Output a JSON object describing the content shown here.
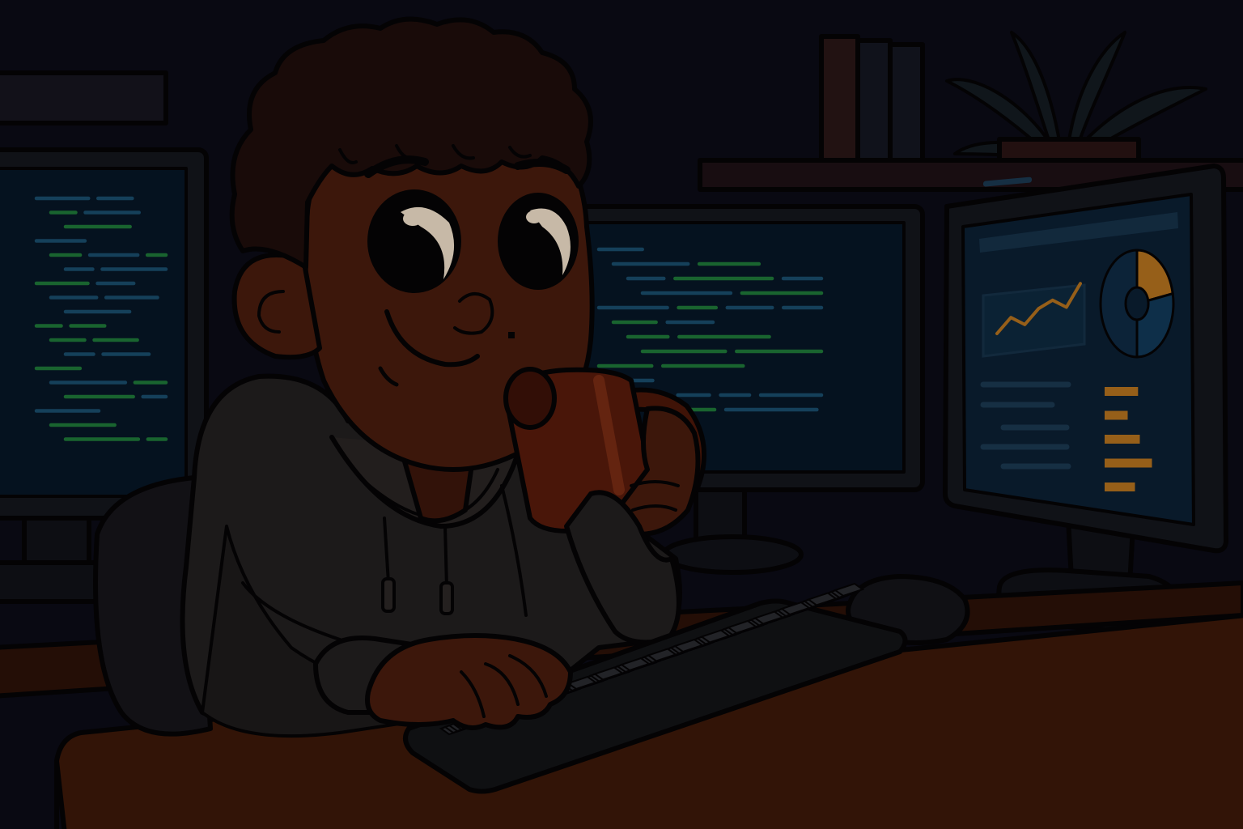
{
  "scene": {
    "background_color": "#0b0a14",
    "wall_color": "#0f0e1c",
    "desk_color": "#3a1608",
    "desk_top_color": "#4a1d0a",
    "skin_color": "#4a1d0e",
    "hoodie_color": "#232020",
    "hair_color": "#1f0e0c",
    "mug_color": "#5a1c0c",
    "keyboard_color": "#131417",
    "screen_color": "#071626",
    "code_green": "#1f7a3a",
    "code_blue": "#1a4f6e",
    "accent_orange": "#b8741f"
  },
  "right_monitor": {
    "line_chart": [
      2,
      4,
      3,
      5,
      6,
      5,
      8
    ],
    "donut_segments": [
      0.22,
      0.28,
      0.5
    ],
    "bar_values": [
      0.55,
      0.38,
      0.58,
      0.78,
      0.5
    ]
  },
  "icons": {
    "plant": "plant-icon",
    "books": "books-icon",
    "mug": "mug-icon"
  }
}
